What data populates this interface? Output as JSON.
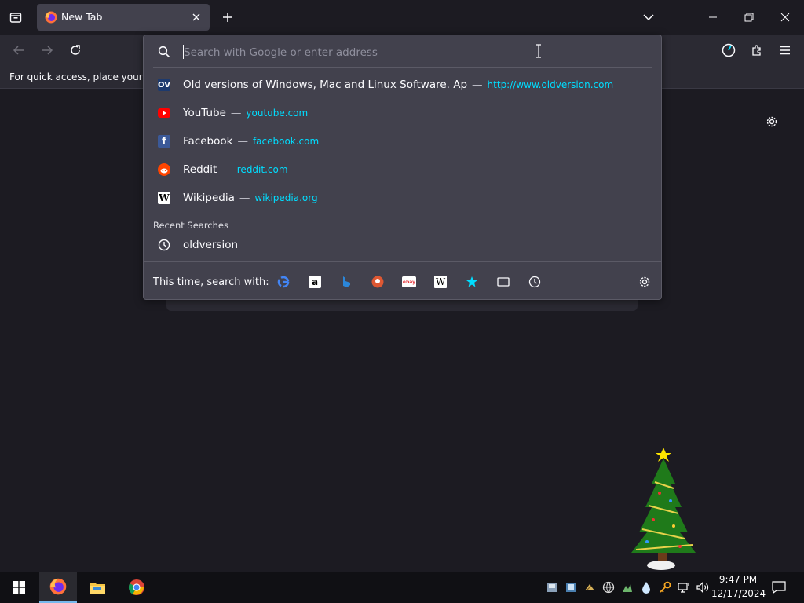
{
  "tab": {
    "title": "New Tab"
  },
  "urlbar": {
    "placeholder": "Search with Google or enter address"
  },
  "bookmarks_bar": {
    "text": "For quick access, place your bookmarks here on the bookmarks toolbar."
  },
  "suggestions": [
    {
      "icon": "oldversion-favicon",
      "favicon_text": "OV",
      "title": "Old versions of Windows, Mac and Linux Software. Ap",
      "sep": "—",
      "url": "http://www.oldversion.com"
    },
    {
      "icon": "youtube-favicon",
      "favicon_text": "",
      "title": "YouTube",
      "sep": "—",
      "url": "youtube.com"
    },
    {
      "icon": "facebook-favicon",
      "favicon_text": "f",
      "title": "Facebook",
      "sep": "—",
      "url": "facebook.com"
    },
    {
      "icon": "reddit-favicon",
      "favicon_text": "",
      "title": "Reddit",
      "sep": "—",
      "url": "reddit.com"
    },
    {
      "icon": "wikipedia-favicon",
      "favicon_text": "W",
      "title": "Wikipedia",
      "sep": "—",
      "url": "wikipedia.org"
    }
  ],
  "recent_searches": {
    "label": "Recent Searches",
    "items": [
      {
        "text": "oldversion"
      }
    ]
  },
  "search_with": {
    "label": "This time, search with:",
    "engines": [
      "google-icon",
      "amazon-icon",
      "bing-icon",
      "duckduckgo-icon",
      "ebay-icon",
      "wikipedia-icon",
      "bookmarks-star-icon",
      "tabs-icon",
      "history-icon"
    ],
    "engine_glyphs": {
      "amazon": "a",
      "ebay": "ebay",
      "wikipedia": "W"
    }
  },
  "clock": {
    "time": "9:47 PM",
    "date": "12/17/2024"
  },
  "colors": {
    "accent_url": "#00ddff",
    "panel": "#42414d",
    "toolbar": "#2b2a33",
    "background": "#1c1b22"
  }
}
